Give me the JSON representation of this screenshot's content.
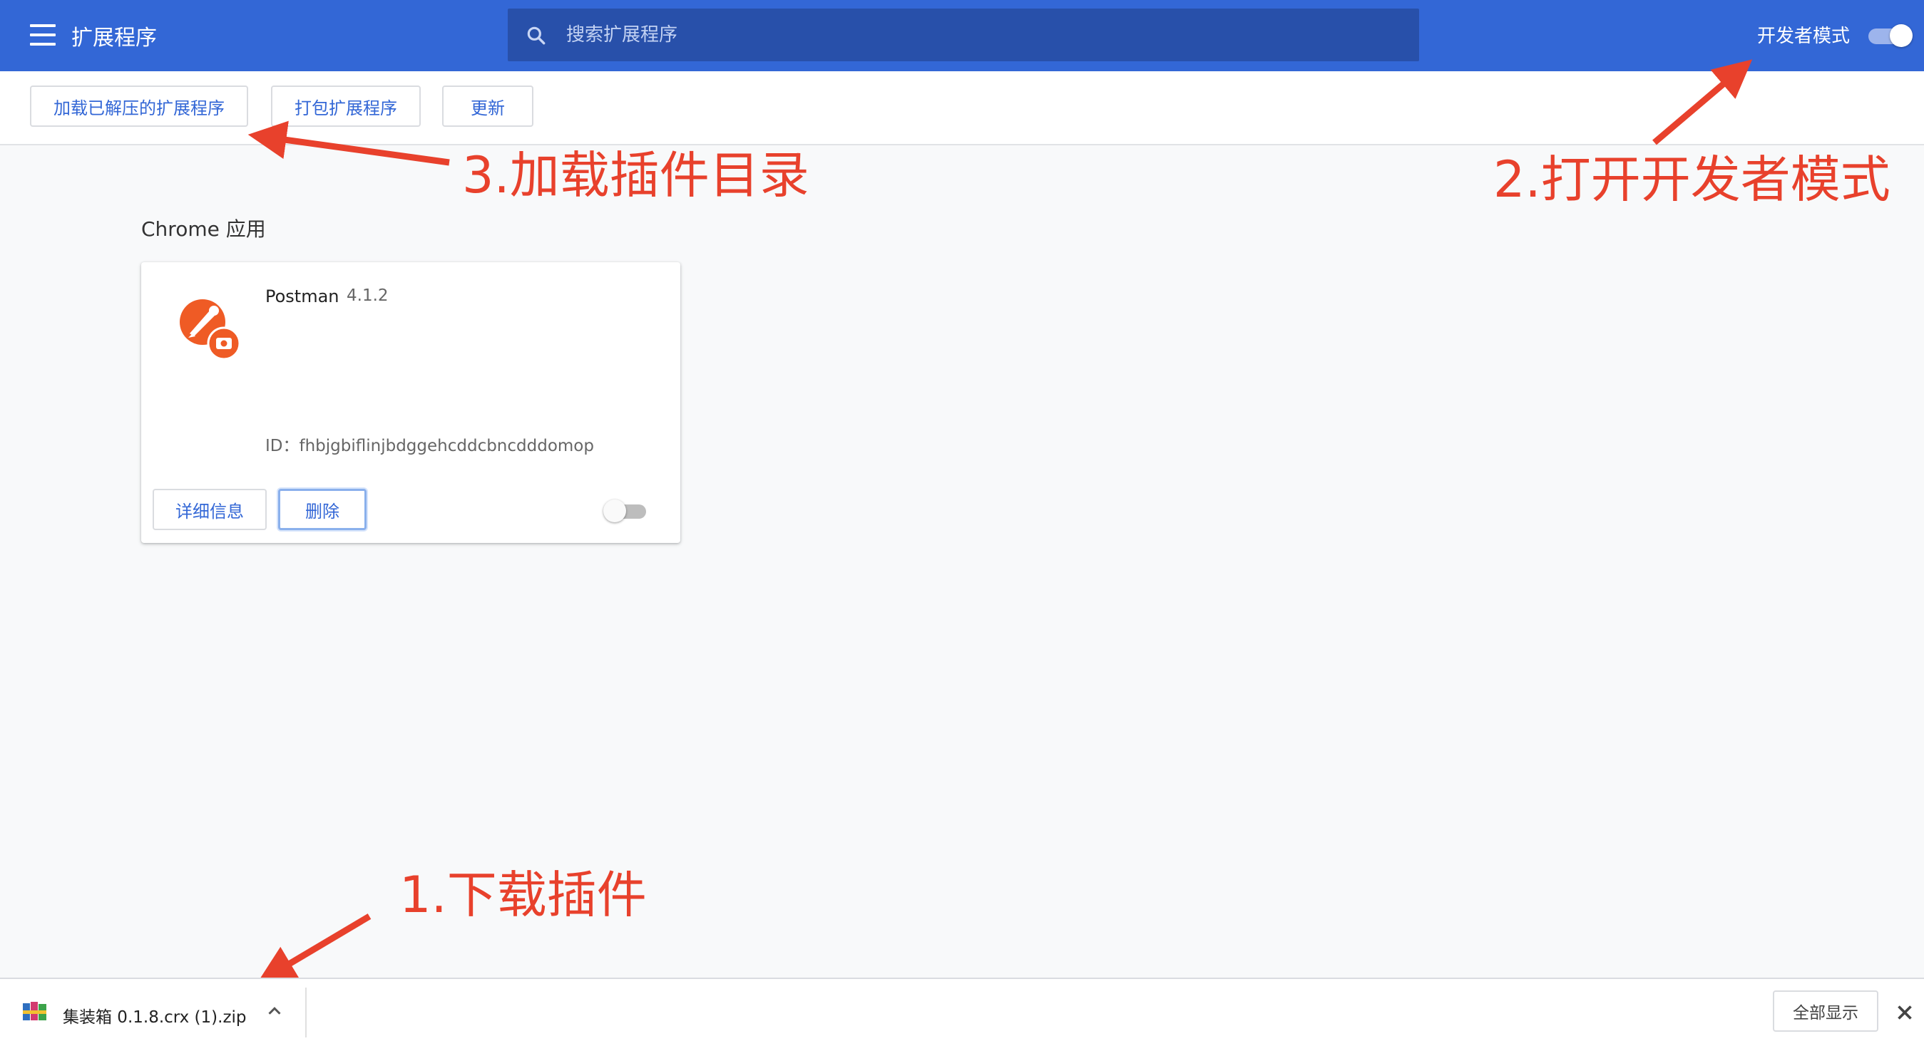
{
  "header": {
    "title": "扩展程序",
    "search_placeholder": "搜索扩展程序",
    "dev_mode_label": "开发者模式",
    "dev_mode_on": true
  },
  "toolbar": {
    "load_unpacked": "加载已解压的扩展程序",
    "pack": "打包扩展程序",
    "update": "更新"
  },
  "annotations": {
    "step1": "1.下载插件",
    "step2": "2.打开开发者模式",
    "step3": "3.加载插件目录",
    "color": "#e8412c"
  },
  "section": {
    "title": "Chrome 应用"
  },
  "app_card": {
    "name": "Postman",
    "version": "4.1.2",
    "id_text": "ID：fhbjgbiflinjbdggehcddcbncdddomop",
    "details_label": "详细信息",
    "remove_label": "删除",
    "enabled": false,
    "icon": "postman-icon"
  },
  "download_shelf": {
    "filename": "集装箱 0.1.8.crx (1).zip",
    "file_icon": "winrar-archive-icon",
    "show_all_label": "全部显示"
  },
  "colors": {
    "header_blue": "#3367d6",
    "search_bg": "#2850aa",
    "accent": "#3367d6",
    "page_bg": "#f8f9fa"
  }
}
